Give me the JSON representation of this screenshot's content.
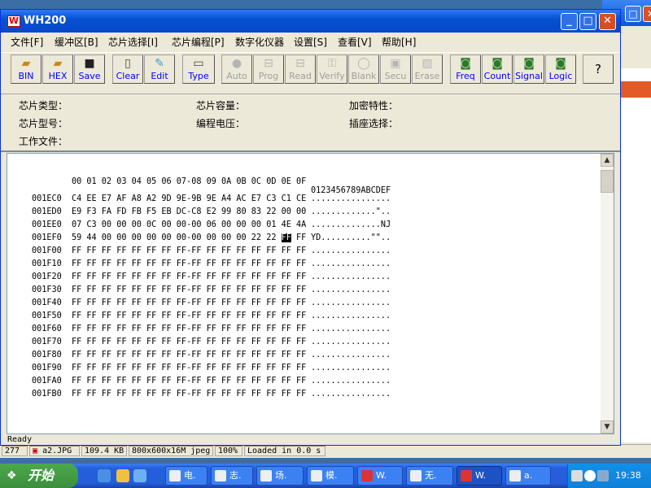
{
  "window": {
    "title": "WH200",
    "app_icon": "W",
    "caption_buttons": {
      "minimize": "_",
      "maximize": "□",
      "close": "✕"
    }
  },
  "menu": [
    "文件[F]",
    "缓冲区[B]",
    "芯片选择[I]",
    "芯片编程[P]",
    "数字化仪器",
    "设置[S]",
    "查看[V]",
    "帮助[H]"
  ],
  "toolbar": [
    {
      "label": "BIN",
      "icon": "open-folder-icon",
      "enabled": true
    },
    {
      "label": "HEX",
      "icon": "open-folder-icon",
      "enabled": true
    },
    {
      "label": "Save",
      "icon": "floppy-icon",
      "enabled": true
    },
    {
      "label": "Clear",
      "icon": "blank-page-icon",
      "enabled": true
    },
    {
      "label": "Edit",
      "icon": "pencil-icon",
      "enabled": true
    },
    {
      "label": "Type",
      "icon": "chip-icon",
      "enabled": true
    },
    {
      "label": "Auto",
      "icon": "auto-icon",
      "enabled": false
    },
    {
      "label": "Prog",
      "icon": "program-icon",
      "enabled": false
    },
    {
      "label": "Read",
      "icon": "read-icon",
      "enabled": false
    },
    {
      "label": "Verify",
      "icon": "key-icon",
      "enabled": false
    },
    {
      "label": "Blank",
      "icon": "bulb-icon",
      "enabled": false
    },
    {
      "label": "Secu",
      "icon": "lock-icon",
      "enabled": false
    },
    {
      "label": "Erase",
      "icon": "eraser-icon",
      "enabled": false
    },
    {
      "label": "Freq",
      "icon": "meter-icon",
      "enabled": true
    },
    {
      "label": "Count",
      "icon": "meter-icon",
      "enabled": true
    },
    {
      "label": "Signal",
      "icon": "meter-icon",
      "enabled": true
    },
    {
      "label": "Logic",
      "icon": "meter-icon",
      "enabled": true
    },
    {
      "label": "?",
      "icon": "help-icon",
      "enabled": true
    }
  ],
  "info": {
    "chip_type": "芯片类型：",
    "chip_capacity": "芯片容量：",
    "encryption": "加密特性：",
    "chip_model": "芯片型号：",
    "prog_voltage": "编程电压：",
    "socket": "插座选择：",
    "work_file": "工作文件："
  },
  "hex": {
    "header_hex": "00 01 02 03 04 05 06 07-08 09 0A 0B 0C 0D 0E 0F",
    "header_ascii": "0123456789ABCDEF",
    "rows": [
      {
        "addr": "001EC0",
        "hex": "C4 EE E7 AF A8 A2 9D 9E-9B 9E A4 AC E7 C3 C1 CE",
        "ascii": "................"
      },
      {
        "addr": "001ED0",
        "hex": "E9 F3 FA FD FB F5 EB DC-C8 E2 99 80 83 22 00 00",
        "ascii": ".............\".."
      },
      {
        "addr": "001EE0",
        "hex": "07 C3 00 00 00 0C 00 00-00 06 00 00 00 01 4E 4A",
        "ascii": "..............NJ"
      },
      {
        "addr": "001EF0",
        "hex": "59 44 00 00 00 00 00 00-00 00 00 00 22 22 ",
        "hex_cursor": "FF",
        "hex_tail": " FF",
        "ascii": "YD..........\"\".."
      },
      {
        "addr": "001F00",
        "hex": "FF FF FF FF FF FF FF FF-FF FF FF FF FF FF FF FF",
        "ascii": "................"
      },
      {
        "addr": "001F10",
        "hex": "FF FF FF FF FF FF FF FF-FF FF FF FF FF FF FF FF",
        "ascii": "................"
      },
      {
        "addr": "001F20",
        "hex": "FF FF FF FF FF FF FF FF-FF FF FF FF FF FF FF FF",
        "ascii": "................"
      },
      {
        "addr": "001F30",
        "hex": "FF FF FF FF FF FF FF FF-FF FF FF FF FF FF FF FF",
        "ascii": "................"
      },
      {
        "addr": "001F40",
        "hex": "FF FF FF FF FF FF FF FF-FF FF FF FF FF FF FF FF",
        "ascii": "................"
      },
      {
        "addr": "001F50",
        "hex": "FF FF FF FF FF FF FF FF-FF FF FF FF FF FF FF FF",
        "ascii": "................"
      },
      {
        "addr": "001F60",
        "hex": "FF FF FF FF FF FF FF FF-FF FF FF FF FF FF FF FF",
        "ascii": "................"
      },
      {
        "addr": "001F70",
        "hex": "FF FF FF FF FF FF FF FF-FF FF FF FF FF FF FF FF",
        "ascii": "................"
      },
      {
        "addr": "001F80",
        "hex": "FF FF FF FF FF FF FF FF-FF FF FF FF FF FF FF FF",
        "ascii": "................"
      },
      {
        "addr": "001F90",
        "hex": "FF FF FF FF FF FF FF FF-FF FF FF FF FF FF FF FF",
        "ascii": "................"
      },
      {
        "addr": "001FA0",
        "hex": "FF FF FF FF FF FF FF FF-FF FF FF FF FF FF FF FF",
        "ascii": "................"
      },
      {
        "addr": "001FB0",
        "hex": "FF FF FF FF FF FF FF FF-FF FF FF FF FF FF FF FF",
        "ascii": "................"
      }
    ]
  },
  "status": "Ready",
  "bg_status": [
    "277",
    "a2.JPG",
    "109.4 KB",
    "800x600x16M jpeg",
    "100%",
    "Loaded in 0.0 s"
  ],
  "taskbar": {
    "start": "开始",
    "tasks": [
      "电.",
      "志.",
      "场.",
      "模.",
      "W.",
      "无.",
      "W.",
      "a."
    ],
    "clock": "19:38"
  }
}
